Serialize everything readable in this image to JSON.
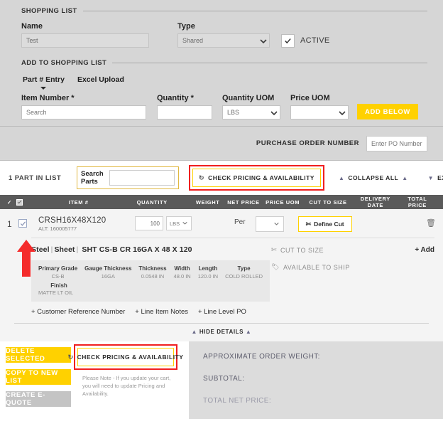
{
  "shopping_list": {
    "legend": "SHOPPING LIST",
    "name_label": "Name",
    "name_value": "Test",
    "type_label": "Type",
    "type_value": "Shared",
    "active_label": "ACTIVE"
  },
  "add_to_list": {
    "legend": "ADD TO SHOPPING LIST",
    "tabs": [
      {
        "label": "Part # Entry",
        "active": true
      },
      {
        "label": "Excel Upload",
        "active": false
      }
    ],
    "item_number_label": "Item Number *",
    "item_number_placeholder": "Search",
    "quantity_label": "Quantity *",
    "quantity_value": "",
    "quantity_uom_label": "Quantity UOM",
    "quantity_uom_value": "LBS",
    "price_uom_label": "Price UOM",
    "price_uom_value": "",
    "add_below_label": "ADD BELOW"
  },
  "po_bar": {
    "label": "PURCHASE ORDER NUMBER",
    "placeholder": "Enter PO Number"
  },
  "toolbar": {
    "parts_count": "1 PART IN LIST",
    "search_parts_label_line1": "Search",
    "search_parts_label_line2": "Parts",
    "search_parts_value": "",
    "check_pricing_label": "CHECK PRICING & AVAILABILITY",
    "collapse_all_label": "COLLAPSE ALL",
    "expand_all_label": "EXPAND ALL"
  },
  "table": {
    "headers": [
      "ITEM #",
      "QUANTITY",
      "WEIGHT",
      "NET PRICE",
      "PRICE UOM",
      "CUT TO SIZE",
      "DELIVERY DATE",
      "TOTAL PRICE"
    ]
  },
  "item": {
    "index": "1",
    "name": "CRSH16X48X120",
    "alt": "ALT: 160005777",
    "quantity": "100",
    "quantity_uom": "LBS",
    "per_label": "Per",
    "price_uom": "",
    "define_cut_label": "Define Cut",
    "category": "Steel",
    "form": "Sheet",
    "description": "SHT CS-B CR 16GA X 48 X 120",
    "specs": [
      {
        "header": "Primary Grade",
        "value": "CS-B"
      },
      {
        "header": "Gauge Thickness",
        "value": "16GA"
      },
      {
        "header": "Thickness",
        "value": "0.0548 IN"
      },
      {
        "header": "Width",
        "value": "48.0 IN"
      },
      {
        "header": "Length",
        "value": "120.0 IN"
      },
      {
        "header": "Type",
        "value": "COLD ROLLED"
      }
    ],
    "finish_header": "Finish",
    "finish_value": "MATTE LT OIL",
    "plus_links": [
      "+ Customer Reference Number",
      "+ Line Item Notes",
      "+ Line Level PO"
    ],
    "cut_to_size_label": "CUT TO SIZE",
    "add_label": "+ Add",
    "available_to_ship_label": "AVAILABLE TO SHIP",
    "hide_details_label": "HIDE DETAILS"
  },
  "footer": {
    "delete_selected_label": "DELETE SELECTED",
    "copy_to_new_list_label": "COPY TO NEW LIST",
    "create_equote_label": "CREATE E-QUOTE",
    "check_pricing_label": "CHECK PRICING & AVAILABILITY",
    "note": "Please Note - If you update your cart, you will need to update Pricing and Availability.",
    "summary": [
      {
        "label": "APPROXIMATE ORDER WEIGHT:",
        "dim": false
      },
      {
        "label": "SUBTOTAL:",
        "dim": false
      },
      {
        "label": "TOTAL NET PRICE:",
        "dim": true
      }
    ]
  },
  "colors": {
    "accent_yellow": "#ffd100",
    "highlight_red": "#f01f1f",
    "header_gray": "#5a5a5a",
    "panel_gray": "#d6d6d6"
  }
}
